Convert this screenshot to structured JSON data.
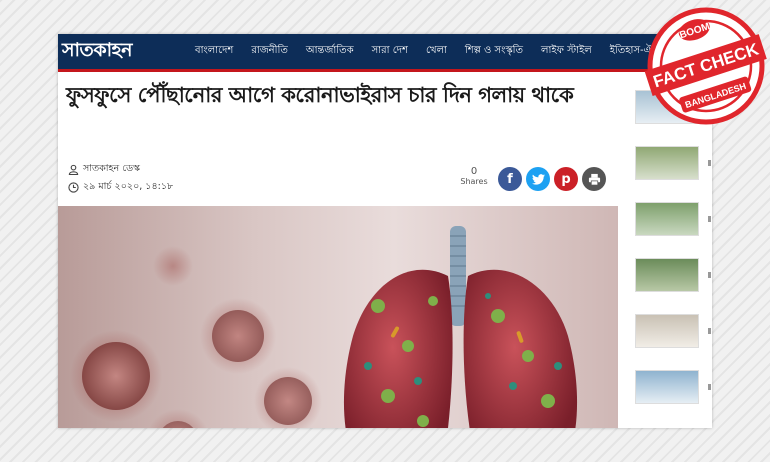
{
  "site": {
    "logo_text": "সাতকাহন"
  },
  "nav": {
    "items": [
      "বাংলাদেশ",
      "রাজনীতি",
      "আন্তর্জাতিক",
      "সারা দেশ",
      "খেলা",
      "শিল্প ও সংস্কৃতি",
      "লাইফ স্টাইল",
      "ইতিহাস-ঐতিহ্য"
    ]
  },
  "article": {
    "headline": "ফুসফুসে পৌঁছানোর আগে করোনাভাইরাস চার দিন গলায় থাকে",
    "author": "সাতকাহন ডেস্ক",
    "date": "২৯ মার্চ ২০২০, ১৪:১৮",
    "share_count": "0",
    "share_label": "Shares"
  },
  "social": {
    "facebook": "f",
    "twitter": "t",
    "pinterest": "p",
    "print": "⎙"
  },
  "badge": {
    "top": "BOOM",
    "main": "FACT CHECK",
    "bottom": "BANGLADESH"
  },
  "colors": {
    "nav_bg": "#0d2d58",
    "nav_accent": "#c4161c",
    "badge_red": "#e0262c",
    "facebook": "#3b5998",
    "twitter": "#1da1f2",
    "pinterest": "#cb2027"
  }
}
